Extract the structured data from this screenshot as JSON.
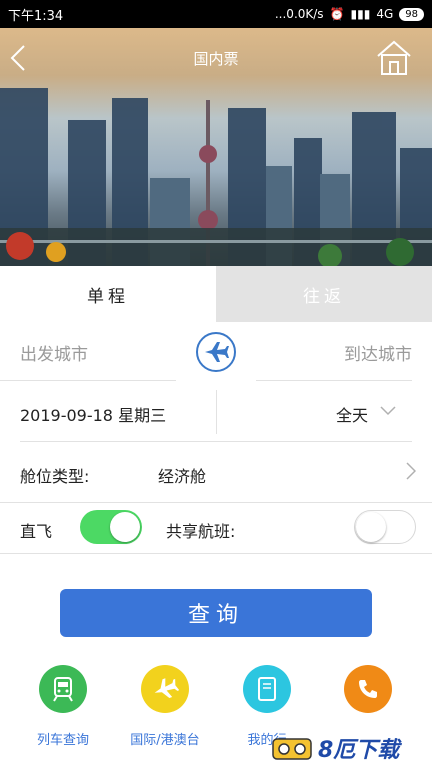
{
  "status_bar": {
    "time": "下午1:34",
    "network_speed": "...0.0K/s",
    "network_type": "4G",
    "battery": "98"
  },
  "header": {
    "title": "国内票"
  },
  "tabs": [
    {
      "label": "单程",
      "active": true
    },
    {
      "label": "往返",
      "active": false
    }
  ],
  "form": {
    "departure_city_placeholder": "出发城市",
    "arrival_city_placeholder": "到达城市",
    "date": "2019-09-18 星期三",
    "time_range": "全天",
    "cabin_label": "舱位类型:",
    "cabin_value": "经济舱",
    "direct_label": "直飞",
    "direct_on": true,
    "shared_label": "共享航班:",
    "shared_on": false
  },
  "query_button": "查询",
  "quick_links": [
    {
      "label": "列车查询",
      "icon": "train-icon",
      "color": "#3cb956"
    },
    {
      "label": "国际/港澳台",
      "icon": "airplane-icon",
      "color": "#f2d21d"
    },
    {
      "label": "我的行",
      "icon": "booklet-icon",
      "color": "#2cc6e0"
    },
    {
      "label": "",
      "icon": "phone-icon",
      "color": "#f08a16"
    }
  ],
  "watermark_text": "8厄下载",
  "colors": {
    "accent": "#3a75d8",
    "toggle_on": "#4cd964"
  }
}
